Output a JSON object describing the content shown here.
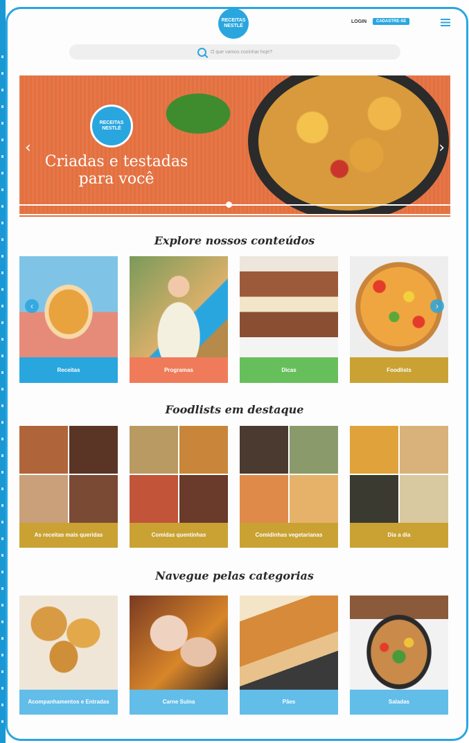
{
  "header": {
    "logo_text": "RECEITAS NESTLÉ",
    "login_label": "LOGIN",
    "signup_label": "CADASTRE-SE",
    "search_placeholder": "O que vamos cozinhar hoje?"
  },
  "hero": {
    "badge_text": "RECEITAS NESTLÉ",
    "title": "Criadas e testadas para você",
    "prev_arrow": "‹",
    "next_arrow": "›"
  },
  "sections": {
    "explore_title": "Explore nossos conteúdos",
    "foodlists_title": "Foodlists em destaque",
    "categories_title": "Navegue pelas categorias"
  },
  "explore": [
    {
      "label": "Receitas",
      "color": "#2aa6df"
    },
    {
      "label": "Programas",
      "color": "#ef7b5a"
    },
    {
      "label": "Dicas",
      "color": "#67bf5c"
    },
    {
      "label": "Foodlists",
      "color": "#c9a233"
    }
  ],
  "explore_nav": {
    "prev": "‹",
    "next": "›"
  },
  "foodlists": [
    {
      "label": "As receitas mais queridas",
      "color": "#c9a233"
    },
    {
      "label": "Comidas quentinhas",
      "color": "#c9a233"
    },
    {
      "label": "Comidinhas vegetarianas",
      "color": "#c9a233"
    },
    {
      "label": "Dia a dia",
      "color": "#c9a233"
    }
  ],
  "categories": [
    {
      "label": "Acompanhamentos e Entradas",
      "color": "#62bde8"
    },
    {
      "label": "Carne Suína",
      "color": "#62bde8"
    },
    {
      "label": "Pães",
      "color": "#62bde8"
    },
    {
      "label": "Saladas",
      "color": "#62bde8"
    }
  ]
}
